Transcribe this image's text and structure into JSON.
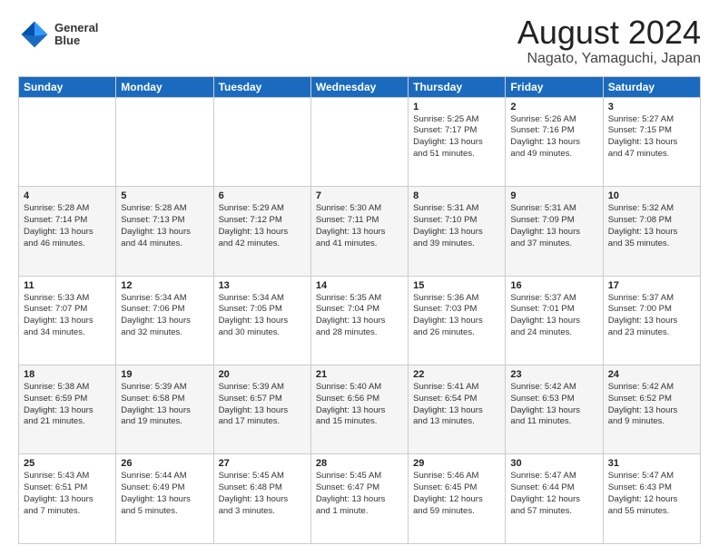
{
  "logo": {
    "line1": "General",
    "line2": "Blue"
  },
  "title": "August 2024",
  "subtitle": "Nagato, Yamaguchi, Japan",
  "days_header": [
    "Sunday",
    "Monday",
    "Tuesday",
    "Wednesday",
    "Thursday",
    "Friday",
    "Saturday"
  ],
  "weeks": [
    [
      {
        "day": "",
        "info": ""
      },
      {
        "day": "",
        "info": ""
      },
      {
        "day": "",
        "info": ""
      },
      {
        "day": "",
        "info": ""
      },
      {
        "day": "1",
        "info": "Sunrise: 5:25 AM\nSunset: 7:17 PM\nDaylight: 13 hours\nand 51 minutes."
      },
      {
        "day": "2",
        "info": "Sunrise: 5:26 AM\nSunset: 7:16 PM\nDaylight: 13 hours\nand 49 minutes."
      },
      {
        "day": "3",
        "info": "Sunrise: 5:27 AM\nSunset: 7:15 PM\nDaylight: 13 hours\nand 47 minutes."
      }
    ],
    [
      {
        "day": "4",
        "info": "Sunrise: 5:28 AM\nSunset: 7:14 PM\nDaylight: 13 hours\nand 46 minutes."
      },
      {
        "day": "5",
        "info": "Sunrise: 5:28 AM\nSunset: 7:13 PM\nDaylight: 13 hours\nand 44 minutes."
      },
      {
        "day": "6",
        "info": "Sunrise: 5:29 AM\nSunset: 7:12 PM\nDaylight: 13 hours\nand 42 minutes."
      },
      {
        "day": "7",
        "info": "Sunrise: 5:30 AM\nSunset: 7:11 PM\nDaylight: 13 hours\nand 41 minutes."
      },
      {
        "day": "8",
        "info": "Sunrise: 5:31 AM\nSunset: 7:10 PM\nDaylight: 13 hours\nand 39 minutes."
      },
      {
        "day": "9",
        "info": "Sunrise: 5:31 AM\nSunset: 7:09 PM\nDaylight: 13 hours\nand 37 minutes."
      },
      {
        "day": "10",
        "info": "Sunrise: 5:32 AM\nSunset: 7:08 PM\nDaylight: 13 hours\nand 35 minutes."
      }
    ],
    [
      {
        "day": "11",
        "info": "Sunrise: 5:33 AM\nSunset: 7:07 PM\nDaylight: 13 hours\nand 34 minutes."
      },
      {
        "day": "12",
        "info": "Sunrise: 5:34 AM\nSunset: 7:06 PM\nDaylight: 13 hours\nand 32 minutes."
      },
      {
        "day": "13",
        "info": "Sunrise: 5:34 AM\nSunset: 7:05 PM\nDaylight: 13 hours\nand 30 minutes."
      },
      {
        "day": "14",
        "info": "Sunrise: 5:35 AM\nSunset: 7:04 PM\nDaylight: 13 hours\nand 28 minutes."
      },
      {
        "day": "15",
        "info": "Sunrise: 5:36 AM\nSunset: 7:03 PM\nDaylight: 13 hours\nand 26 minutes."
      },
      {
        "day": "16",
        "info": "Sunrise: 5:37 AM\nSunset: 7:01 PM\nDaylight: 13 hours\nand 24 minutes."
      },
      {
        "day": "17",
        "info": "Sunrise: 5:37 AM\nSunset: 7:00 PM\nDaylight: 13 hours\nand 23 minutes."
      }
    ],
    [
      {
        "day": "18",
        "info": "Sunrise: 5:38 AM\nSunset: 6:59 PM\nDaylight: 13 hours\nand 21 minutes."
      },
      {
        "day": "19",
        "info": "Sunrise: 5:39 AM\nSunset: 6:58 PM\nDaylight: 13 hours\nand 19 minutes."
      },
      {
        "day": "20",
        "info": "Sunrise: 5:39 AM\nSunset: 6:57 PM\nDaylight: 13 hours\nand 17 minutes."
      },
      {
        "day": "21",
        "info": "Sunrise: 5:40 AM\nSunset: 6:56 PM\nDaylight: 13 hours\nand 15 minutes."
      },
      {
        "day": "22",
        "info": "Sunrise: 5:41 AM\nSunset: 6:54 PM\nDaylight: 13 hours\nand 13 minutes."
      },
      {
        "day": "23",
        "info": "Sunrise: 5:42 AM\nSunset: 6:53 PM\nDaylight: 13 hours\nand 11 minutes."
      },
      {
        "day": "24",
        "info": "Sunrise: 5:42 AM\nSunset: 6:52 PM\nDaylight: 13 hours\nand 9 minutes."
      }
    ],
    [
      {
        "day": "25",
        "info": "Sunrise: 5:43 AM\nSunset: 6:51 PM\nDaylight: 13 hours\nand 7 minutes."
      },
      {
        "day": "26",
        "info": "Sunrise: 5:44 AM\nSunset: 6:49 PM\nDaylight: 13 hours\nand 5 minutes."
      },
      {
        "day": "27",
        "info": "Sunrise: 5:45 AM\nSunset: 6:48 PM\nDaylight: 13 hours\nand 3 minutes."
      },
      {
        "day": "28",
        "info": "Sunrise: 5:45 AM\nSunset: 6:47 PM\nDaylight: 13 hours\nand 1 minute."
      },
      {
        "day": "29",
        "info": "Sunrise: 5:46 AM\nSunset: 6:45 PM\nDaylight: 12 hours\nand 59 minutes."
      },
      {
        "day": "30",
        "info": "Sunrise: 5:47 AM\nSunset: 6:44 PM\nDaylight: 12 hours\nand 57 minutes."
      },
      {
        "day": "31",
        "info": "Sunrise: 5:47 AM\nSunset: 6:43 PM\nDaylight: 12 hours\nand 55 minutes."
      }
    ]
  ]
}
